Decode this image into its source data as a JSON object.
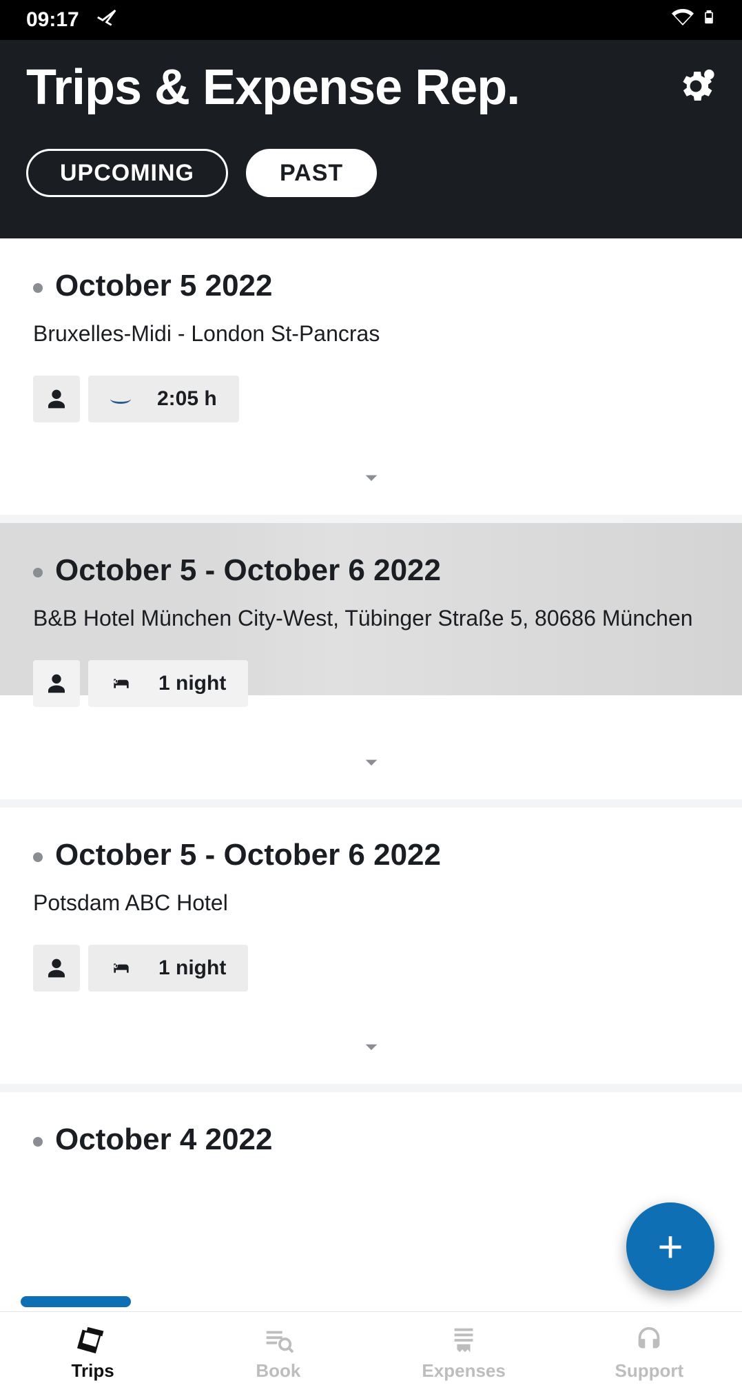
{
  "statusbar": {
    "time": "09:17"
  },
  "header": {
    "title": "Trips & Expense Rep."
  },
  "tabs": {
    "upcoming": "UPCOMING",
    "past": "PAST"
  },
  "trips": [
    {
      "date": "October 5 2022",
      "subtitle": "Bruxelles-Midi - London St-Pancras",
      "badge_type": "train",
      "duration": "2:05 h",
      "highlighted": false
    },
    {
      "date": "October 5 - October 6 2022",
      "subtitle": "B&B Hotel München City-West, Tübinger Straße 5, 80686 München",
      "badge_type": "hotel",
      "duration": "1 night",
      "highlighted": true
    },
    {
      "date": "October 5 - October 6 2022",
      "subtitle": "Potsdam ABC Hotel",
      "badge_type": "hotel",
      "duration": "1 night",
      "highlighted": false
    },
    {
      "date": "October 4 2022",
      "subtitle": "",
      "badge_type": "",
      "duration": "",
      "highlighted": false
    }
  ],
  "bottomnav": {
    "trips": "Trips",
    "book": "Book",
    "expenses": "Expenses",
    "support": "Support"
  },
  "fab": {
    "label": "+"
  }
}
